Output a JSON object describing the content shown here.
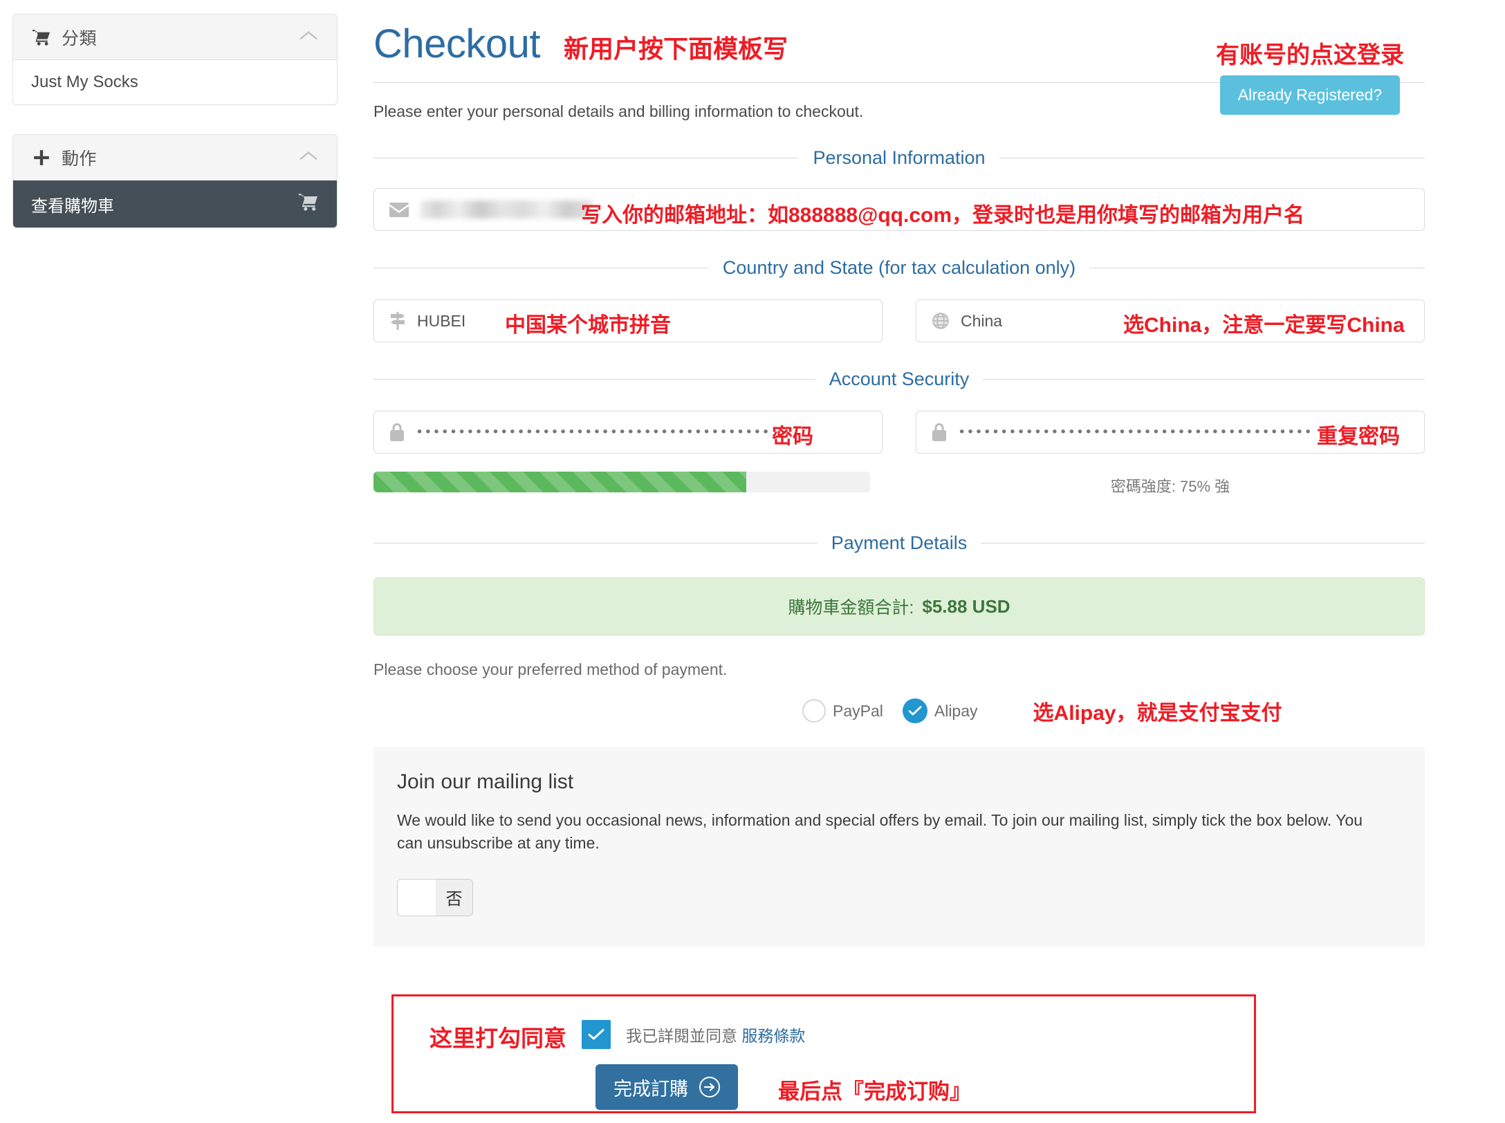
{
  "sidebar": {
    "categories_panel": {
      "icon": "cart-icon",
      "title": "分類",
      "collapse_icon": "chevron-up-icon",
      "items": [
        {
          "label": "Just My Socks"
        }
      ]
    },
    "actions_panel": {
      "icon": "plus-icon",
      "title": "動作",
      "collapse_icon": "chevron-up-icon",
      "items": [
        {
          "label": "查看購物車",
          "icon": "cart-icon"
        }
      ]
    }
  },
  "main": {
    "page_title": "Checkout",
    "title_annotation": "新用户按下面模板写",
    "lead_text": "Please enter your personal details and billing information to checkout.",
    "registered": {
      "annotation": "有账号的点这登录",
      "button_label": "Already Registered?"
    },
    "sections": {
      "personal": {
        "legend": "Personal Information",
        "email": {
          "icon": "envelope-icon",
          "value": "",
          "annotation": "写入你的邮箱地址：如888888@qq.com，登录时也是用你填写的邮箱为用户名"
        }
      },
      "country_state": {
        "legend": "Country and State (for tax calculation only)",
        "state": {
          "icon": "signpost-icon",
          "value": "HUBEI",
          "annotation": "中国某个城市拼音"
        },
        "country": {
          "icon": "globe-icon",
          "value": "China",
          "annotation": "选China，注意一定要写China"
        }
      },
      "account_security": {
        "legend": "Account Security",
        "password": {
          "icon": "lock-icon",
          "value": "••••••••••••••••••••••••••••••••••••••••••",
          "annotation": "密码"
        },
        "confirm_password": {
          "icon": "lock-icon",
          "value": "••••••••••••••••••••••••••••••••••••••••••",
          "annotation": "重复密码"
        },
        "strength": {
          "percent": 75,
          "text": "密碼強度: 75% 強",
          "color": "#5cb85c"
        }
      },
      "payment": {
        "legend": "Payment Details",
        "total_label": "購物車金額合計:",
        "total_value": "$5.88 USD",
        "choose_text": "Please choose your preferred method of payment.",
        "methods": [
          {
            "label": "PayPal",
            "selected": false
          },
          {
            "label": "Alipay",
            "selected": true
          }
        ],
        "method_annotation": "选Alipay，就是支付宝支付"
      },
      "mailing": {
        "heading": "Join our mailing list",
        "body": "We would like to send you occasional news, information and special offers by email. To join our mailing list, simply tick the box below. You can unsubscribe at any time.",
        "toggle_label": "否"
      },
      "finish": {
        "tick_annotation": "这里打勾同意",
        "terms_prefix": "我已詳閱並同意",
        "terms_link": "服務條款",
        "button_label": "完成訂購",
        "button_icon": "arrow-right-circle-icon",
        "final_annotation": "最后点『完成订购』"
      }
    }
  },
  "colors": {
    "accent_blue": "#2d6ca2",
    "annotation_red": "#ee1c25",
    "info_blue": "#5bc0de",
    "success_green": "#5cb85c",
    "alipay_blue": "#2196cf",
    "sidebar_dark": "#454f57"
  }
}
